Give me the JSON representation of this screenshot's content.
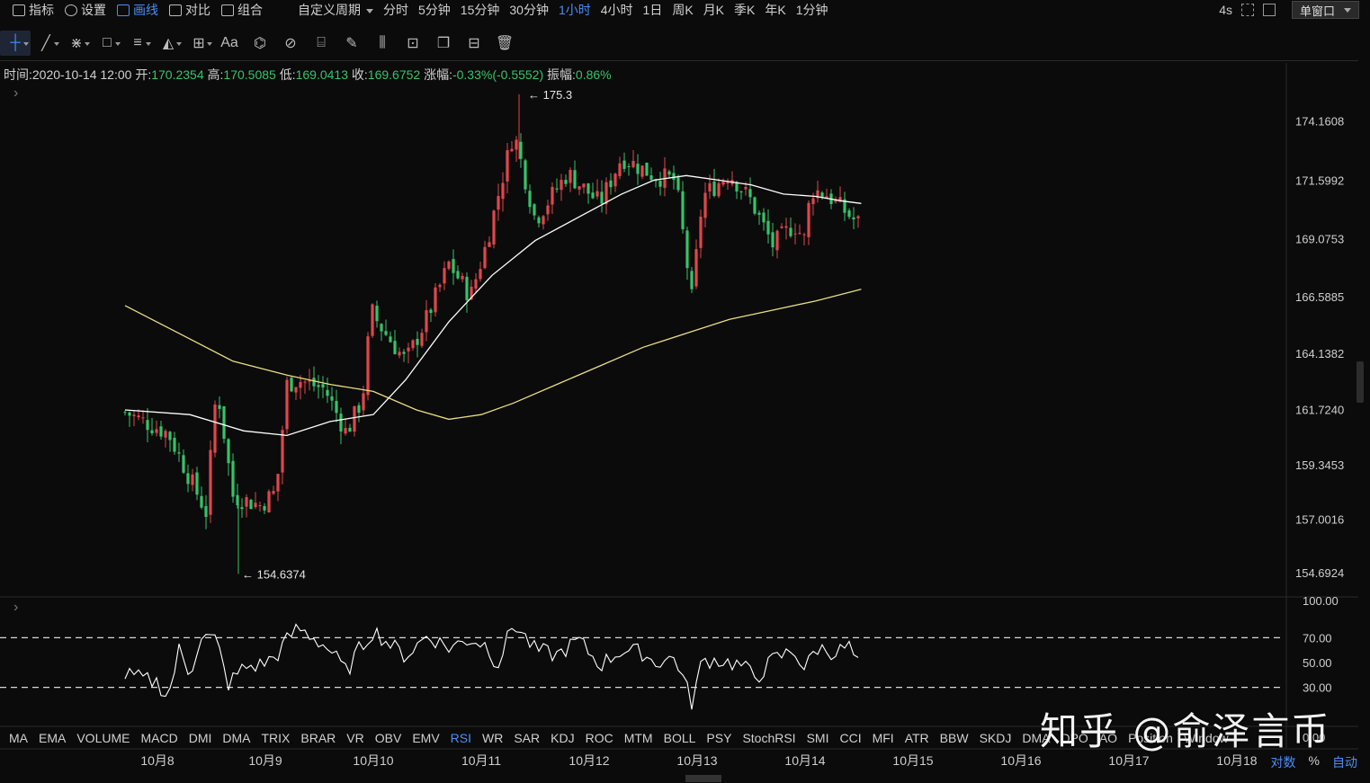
{
  "toolbar": {
    "items": [
      {
        "label": "指标",
        "icon": "indicator-icon"
      },
      {
        "label": "设置",
        "icon": "settings-icon"
      },
      {
        "label": "画线",
        "icon": "draw-line-icon",
        "active": true
      },
      {
        "label": "对比",
        "icon": "compare-icon"
      },
      {
        "label": "组合",
        "icon": "combine-icon"
      }
    ],
    "custom_period": "自定义周期",
    "periods": [
      "分时",
      "5分钟",
      "15分钟",
      "30分钟",
      "1小时",
      "4小时",
      "1日",
      "周K",
      "月K",
      "季K",
      "年K",
      "1分钟"
    ],
    "active_period": "1小时",
    "refresh": "4s",
    "window_mode": "单窗口"
  },
  "drawing_tools": [
    "crosshair-icon",
    "trend-line-icon",
    "multi-line-icon",
    "rectangle-icon",
    "parallel-lines-icon",
    "pattern-icon",
    "measure-icon",
    "text-icon",
    "fibonacci-icon",
    "gann-icon",
    "ruler-icon",
    "brush-icon",
    "bars-icon",
    "lock-icon",
    "clone-icon",
    "settings-grid-icon",
    "trash-icon"
  ],
  "text_tool_label": "Aa",
  "info": {
    "time_label": "时间:",
    "time": "2020-10-14 12:00",
    "open_label": "开:",
    "open": "170.2354",
    "high_label": "高:",
    "high": "170.5085",
    "low_label": "低:",
    "low": "169.0413",
    "close_label": "收:",
    "close": "169.6752",
    "change_label": "涨幅:",
    "change": "-0.33%(-0.5552)",
    "amplitude_label": "振幅:",
    "amplitude": "0.86%"
  },
  "indicator_tabs": [
    "MA",
    "EMA",
    "VOLUME",
    "MACD",
    "DMI",
    "DMA",
    "TRIX",
    "BRAR",
    "VR",
    "OBV",
    "EMV",
    "RSI",
    "WR",
    "SAR",
    "KDJ",
    "ROC",
    "MTM",
    "BOLL",
    "PSY",
    "StochRSI",
    "SMI",
    "CCI",
    "MFI",
    "ATR",
    "BBW",
    "SKDJ",
    "DMA",
    "DPO",
    "AO",
    "Position",
    "Window"
  ],
  "active_indicator": "RSI",
  "scale_options": {
    "log": "对数",
    "percent": "%",
    "auto": "自动"
  },
  "watermark": "知乎 @俞泽言币",
  "colors": {
    "up": "#e0464e",
    "down": "#36c36b",
    "ma_short": "#ffffff",
    "ma_long": "#e8e07a",
    "accent": "#4b8df5",
    "background": "#0b0b0b"
  },
  "chart_data": [
    {
      "type": "candlestick",
      "y_ticks": [
        "174.1608",
        "171.5992",
        "169.0753",
        "166.5885",
        "164.1382",
        "161.7240",
        "159.3453",
        "157.0016",
        "154.6924"
      ],
      "ylim": [
        153.8,
        175.8
      ],
      "x_ticks": [
        "10月8",
        "10月9",
        "10月10",
        "10月11",
        "10月12",
        "10月13",
        "10月14",
        "10月15",
        "10月16",
        "10月17",
        "10月18"
      ],
      "max_marker": "← 175.3",
      "min_marker": "← 154.6374",
      "high_value": 175.3,
      "low_value": 154.6374,
      "close_path": [
        [
          -0.3,
          161.6
        ],
        [
          0.1,
          160.7
        ],
        [
          0.45,
          157.3
        ],
        [
          0.55,
          162.8
        ],
        [
          0.7,
          158.0
        ],
        [
          0.95,
          157.6
        ],
        [
          1.1,
          158.2
        ],
        [
          1.2,
          162.8
        ],
        [
          1.3,
          163.0
        ],
        [
          1.55,
          162.6
        ],
        [
          1.75,
          160.7
        ],
        [
          1.9,
          162.2
        ],
        [
          1.98,
          166.0
        ],
        [
          2.05,
          165.4
        ],
        [
          2.3,
          163.8
        ],
        [
          2.5,
          165.7
        ],
        [
          2.7,
          168.0
        ],
        [
          2.9,
          166.6
        ],
        [
          3.05,
          168.9
        ],
        [
          3.3,
          173.7
        ],
        [
          3.5,
          169.9
        ],
        [
          3.8,
          171.9
        ],
        [
          4.1,
          170.6
        ],
        [
          4.3,
          172.6
        ],
        [
          4.6,
          171.8
        ],
        [
          4.8,
          171.6
        ],
        [
          4.95,
          166.5
        ],
        [
          5.05,
          170.9
        ],
        [
          5.3,
          171.9
        ],
        [
          5.5,
          170.7
        ],
        [
          5.7,
          168.8
        ],
        [
          5.9,
          169.7
        ],
        [
          6.0,
          169.0
        ],
        [
          6.05,
          171.2
        ],
        [
          6.2,
          171.0
        ],
        [
          6.45,
          169.9
        ],
        [
          6.52,
          169.7
        ]
      ],
      "ma_short": [
        [
          -0.3,
          161.7
        ],
        [
          0.3,
          161.5
        ],
        [
          0.8,
          160.8
        ],
        [
          1.2,
          160.6
        ],
        [
          1.6,
          161.2
        ],
        [
          2.0,
          161.5
        ],
        [
          2.3,
          163.0
        ],
        [
          2.7,
          165.5
        ],
        [
          3.1,
          167.5
        ],
        [
          3.5,
          169.0
        ],
        [
          3.9,
          170.0
        ],
        [
          4.3,
          171.0
        ],
        [
          4.6,
          171.6
        ],
        [
          4.9,
          171.8
        ],
        [
          5.2,
          171.6
        ],
        [
          5.5,
          171.4
        ],
        [
          5.8,
          171.0
        ],
        [
          6.1,
          170.9
        ],
        [
          6.35,
          170.7
        ],
        [
          6.52,
          170.6
        ]
      ],
      "ma_long": [
        [
          -0.3,
          166.2
        ],
        [
          0.2,
          165.0
        ],
        [
          0.7,
          163.8
        ],
        [
          1.2,
          163.2
        ],
        [
          1.6,
          162.8
        ],
        [
          2.0,
          162.5
        ],
        [
          2.4,
          161.7
        ],
        [
          2.7,
          161.3
        ],
        [
          3.0,
          161.5
        ],
        [
          3.3,
          162.0
        ],
        [
          3.7,
          162.8
        ],
        [
          4.1,
          163.6
        ],
        [
          4.5,
          164.4
        ],
        [
          4.9,
          165.0
        ],
        [
          5.3,
          165.6
        ],
        [
          5.7,
          166.0
        ],
        [
          6.1,
          166.4
        ],
        [
          6.52,
          166.9
        ]
      ]
    },
    {
      "type": "line",
      "name": "RSI",
      "y_ticks": [
        "100.00",
        "70.00",
        "50.00",
        "30.00",
        "0.00"
      ],
      "ylim": [
        0,
        100
      ],
      "levels": [
        70,
        30
      ],
      "values": [
        [
          -0.3,
          40
        ],
        [
          0.0,
          34
        ],
        [
          0.1,
          22
        ],
        [
          0.2,
          60
        ],
        [
          0.3,
          40
        ],
        [
          0.4,
          72
        ],
        [
          0.55,
          68
        ],
        [
          0.65,
          32
        ],
        [
          0.8,
          46
        ],
        [
          0.95,
          48
        ],
        [
          1.1,
          55
        ],
        [
          1.2,
          68
        ],
        [
          1.3,
          78
        ],
        [
          1.45,
          70
        ],
        [
          1.6,
          60
        ],
        [
          1.75,
          42
        ],
        [
          1.85,
          58
        ],
        [
          2.0,
          76
        ],
        [
          2.15,
          65
        ],
        [
          2.3,
          55
        ],
        [
          2.5,
          72
        ],
        [
          2.7,
          62
        ],
        [
          2.9,
          69
        ],
        [
          3.05,
          64
        ],
        [
          3.15,
          48
        ],
        [
          3.3,
          82
        ],
        [
          3.5,
          60
        ],
        [
          3.7,
          56
        ],
        [
          3.9,
          68
        ],
        [
          4.1,
          48
        ],
        [
          4.3,
          60
        ],
        [
          4.5,
          58
        ],
        [
          4.6,
          50
        ],
        [
          4.8,
          54
        ],
        [
          4.95,
          18
        ],
        [
          5.05,
          52
        ],
        [
          5.2,
          52
        ],
        [
          5.4,
          48
        ],
        [
          5.55,
          38
        ],
        [
          5.7,
          52
        ],
        [
          5.9,
          60
        ],
        [
          6.0,
          44
        ],
        [
          6.1,
          62
        ],
        [
          6.3,
          58
        ],
        [
          6.4,
          64
        ],
        [
          6.52,
          43
        ]
      ]
    }
  ]
}
